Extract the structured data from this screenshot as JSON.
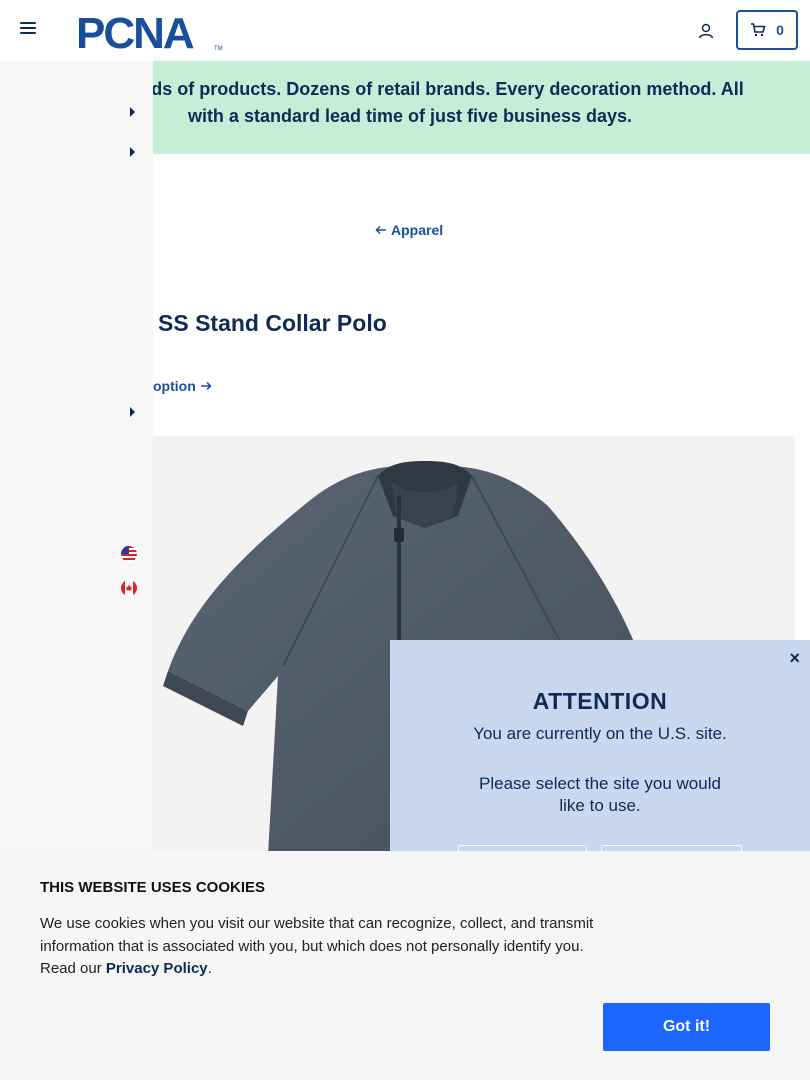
{
  "header": {
    "logo_text": "PCNA",
    "cart_count": "0"
  },
  "banner": {
    "line1": "Thousands of products. Dozens of retail brands. Every decoration method. All",
    "line2": "with a standard lead time of just five business days."
  },
  "breadcrumb": {
    "back_label": "Apparel"
  },
  "product": {
    "title": "SS Stand Collar Polo",
    "option_link": "option",
    "shirt_color": "#4d5866"
  },
  "attention": {
    "heading": "ATTENTION",
    "current_site": "You are currently on the U.S. site.",
    "prompt": "Please select the site you would like to use.",
    "close_icon": "×"
  },
  "cookie": {
    "heading": "THIS WEBSITE USES COOKIES",
    "body": "We use cookies when you visit our website that can recognize, collect, and transmit information that is associated with you, but which does not personally identify you. Read our",
    "link": "Privacy Policy",
    "period": ".",
    "button": "Got it!"
  },
  "colors": {
    "brand_blue": "#1a4f9c",
    "navy": "#0f2a55",
    "banner_green": "#c6eed6",
    "cookie_button": "#1a66ff"
  }
}
